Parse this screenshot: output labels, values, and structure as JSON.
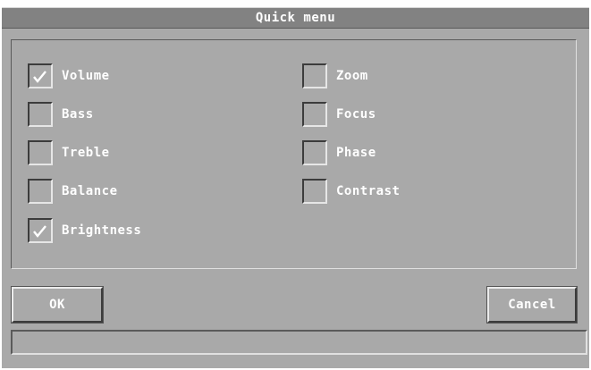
{
  "window": {
    "title": "Quick menu"
  },
  "options": {
    "left": [
      {
        "label": "Volume",
        "checked": true
      },
      {
        "label": "Bass",
        "checked": false
      },
      {
        "label": "Treble",
        "checked": false
      },
      {
        "label": "Balance",
        "checked": false
      },
      {
        "label": "Brightness",
        "checked": true
      }
    ],
    "right": [
      {
        "label": "Zoom",
        "checked": false
      },
      {
        "label": "Focus",
        "checked": false
      },
      {
        "label": "Phase",
        "checked": false
      },
      {
        "label": "Contrast",
        "checked": false
      }
    ]
  },
  "buttons": {
    "ok_label": "OK",
    "cancel_label": "Cancel"
  },
  "status": {
    "text": ""
  },
  "colors": {
    "background": "#a9a9a9",
    "titlebar": "#828282",
    "text": "#ffffff"
  }
}
